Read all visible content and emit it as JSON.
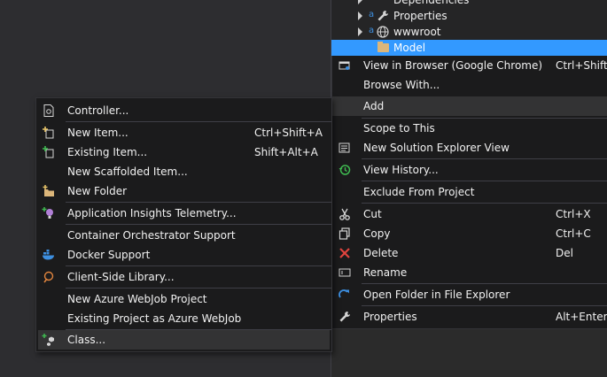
{
  "tree": {
    "items": [
      {
        "label": "Dependencies"
      },
      {
        "label": "Properties"
      },
      {
        "label": "wwwroot"
      },
      {
        "label": "Model"
      }
    ]
  },
  "context_menu": {
    "items": [
      {
        "label": "View in Browser (Google Chrome)",
        "shortcut": "Ctrl+Shift+W"
      },
      {
        "label": "Browse With...",
        "shortcut": ""
      },
      {
        "label": "Add",
        "shortcut": ""
      },
      {
        "label": "Scope to This",
        "shortcut": ""
      },
      {
        "label": "New Solution Explorer View",
        "shortcut": ""
      },
      {
        "label": "View History...",
        "shortcut": ""
      },
      {
        "label": "Exclude From Project",
        "shortcut": ""
      },
      {
        "label": "Cut",
        "shortcut": "Ctrl+X"
      },
      {
        "label": "Copy",
        "shortcut": "Ctrl+C"
      },
      {
        "label": "Delete",
        "shortcut": "Del"
      },
      {
        "label": "Rename",
        "shortcut": ""
      },
      {
        "label": "Open Folder in File Explorer",
        "shortcut": ""
      },
      {
        "label": "Properties",
        "shortcut": "Alt+Enter"
      }
    ]
  },
  "add_submenu": {
    "items": [
      {
        "label": "Controller...",
        "shortcut": ""
      },
      {
        "label": "New Item...",
        "shortcut": "Ctrl+Shift+A"
      },
      {
        "label": "Existing Item...",
        "shortcut": "Shift+Alt+A"
      },
      {
        "label": "New Scaffolded Item...",
        "shortcut": ""
      },
      {
        "label": "New Folder",
        "shortcut": ""
      },
      {
        "label": "Application Insights Telemetry...",
        "shortcut": ""
      },
      {
        "label": "Container Orchestrator Support",
        "shortcut": ""
      },
      {
        "label": "Docker Support",
        "shortcut": ""
      },
      {
        "label": "Client-Side Library...",
        "shortcut": ""
      },
      {
        "label": "New Azure WebJob Project",
        "shortcut": ""
      },
      {
        "label": "Existing Project as Azure WebJob",
        "shortcut": ""
      },
      {
        "label": "Class...",
        "shortcut": ""
      }
    ]
  },
  "colors": {
    "selection": "#3399ff",
    "menu_bg": "#1b1b1c",
    "highlight": "#333334",
    "separator": "#3f3f46"
  }
}
